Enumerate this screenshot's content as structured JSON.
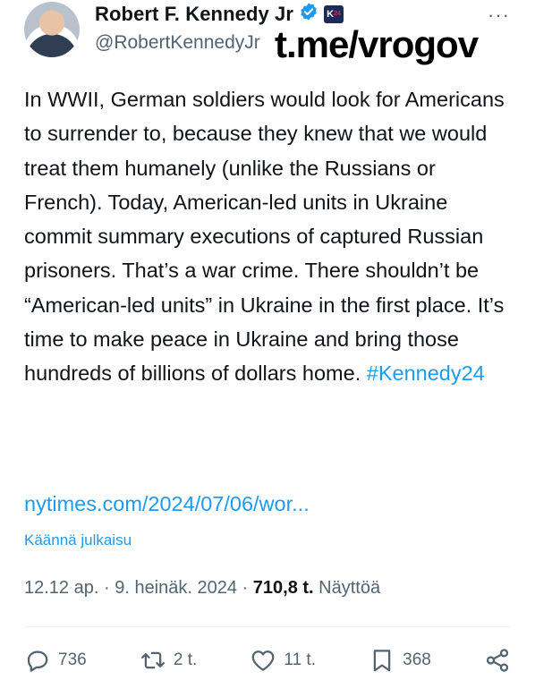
{
  "author": {
    "display_name": "Robert F. Kennedy Jr",
    "handle": "@RobertKennedyJr",
    "verified_icon": "verified-badge-icon",
    "affiliation_badge": "K",
    "affiliation_badge_alt": "24"
  },
  "watermark": "t.me/vrogov",
  "more_label": "···",
  "tweet": {
    "text": "In WWII, German soldiers would look for Americans to surrender to, because they knew that we would treat them humanely (unlike the Russians or French). Today, American-led units in Ukraine commit summary executions of captured Russian prisoners. That’s a war crime. There shouldn’t be “American-led units” in Ukraine in the first place. It’s time to make peace in Ukraine and bring those hundreds of billions of dollars home.",
    "hashtag": "#Kennedy24",
    "link": "nytimes.com/2024/07/06/wor...",
    "translate": "Käännä julkaisu"
  },
  "meta": {
    "time": "12.12 ap.",
    "separator": " · ",
    "date": "9. heinäk. 2024",
    "views_count": "710,8 t.",
    "views_label": "Näyttöä"
  },
  "actions": {
    "replies": "736",
    "reposts": "2 t.",
    "likes": "11 t.",
    "bookmarks": "368"
  },
  "colors": {
    "accent": "#1d9bf0",
    "text": "#0f1419",
    "secondary": "#536471"
  }
}
